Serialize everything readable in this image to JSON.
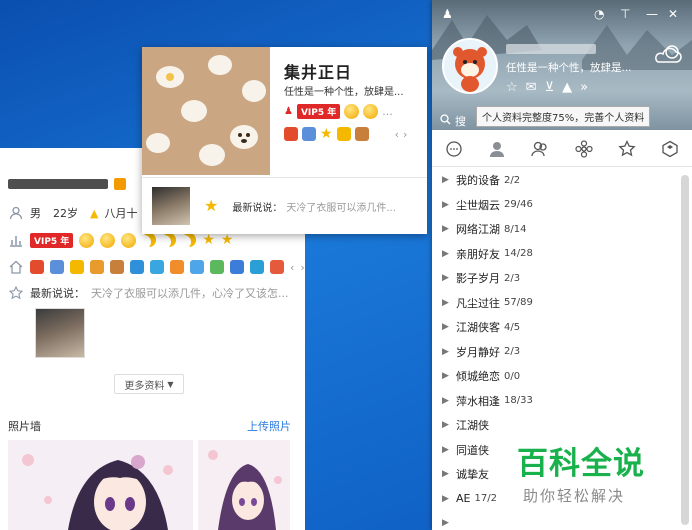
{
  "profile": {
    "gender": "男",
    "age": "22岁",
    "birthday": "八月十",
    "vip_badge": "VIP5 年",
    "latest_label": "最新说说：",
    "latest_text": "天冷了衣服可以添几件，心冷了又该怎...",
    "more_button": "更多资料",
    "photo_wall": "照片墙",
    "upload_photo": "上传照片"
  },
  "hovercard": {
    "name": "集井正日",
    "signature": "任性是一种个性，放肆是...",
    "vip_badge": "VIP5 年",
    "latest_label": "最新说说：",
    "latest_text": "天冷了衣服可以添几件..."
  },
  "qq": {
    "signature": "任性是一种个性，放肆是...",
    "tooltip": "个人资料完整度75%，完善个人资料",
    "search_label": "搜",
    "groups": [
      {
        "name": "我的设备",
        "count": "2/2"
      },
      {
        "name": "尘世烟云",
        "count": "29/46"
      },
      {
        "name": "网络江湖",
        "count": "8/14"
      },
      {
        "name": "亲朋好友",
        "count": "14/28"
      },
      {
        "name": "影子岁月",
        "count": "2/3"
      },
      {
        "name": "凡尘过往",
        "count": "57/89"
      },
      {
        "name": "江湖侠客",
        "count": "4/5"
      },
      {
        "name": "岁月静好",
        "count": "2/3"
      },
      {
        "name": "倾城绝恋",
        "count": "0/0"
      },
      {
        "name": "萍水相逢",
        "count": "18/33"
      },
      {
        "name": "江湖侠",
        "count": ""
      },
      {
        "name": "同道侠",
        "count": ""
      },
      {
        "name": "诚挚友",
        "count": ""
      },
      {
        "name": "AE",
        "count": "17/2"
      },
      {
        "name": "",
        "count": ""
      }
    ]
  },
  "watermark": {
    "main": "百科全说",
    "sub": "助你轻松解决"
  },
  "colors": {
    "vip_red": "#e02828",
    "link_blue": "#2b7be0",
    "watermark_green": "#19b14c",
    "desktop_blue": "#1a78d8"
  }
}
